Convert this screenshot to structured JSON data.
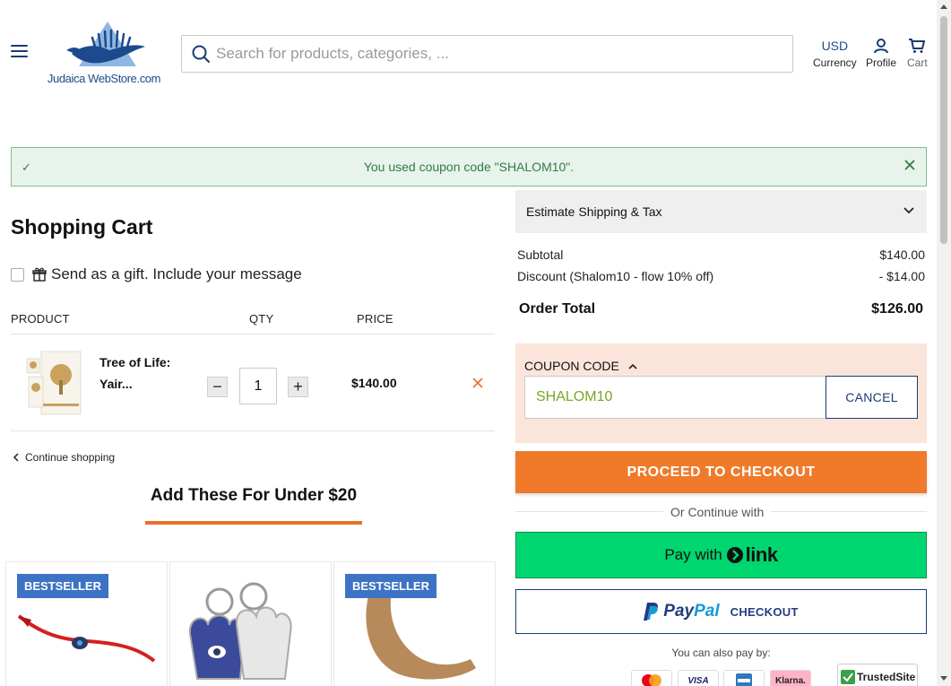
{
  "header": {
    "logo_text": "Judaica WebStore.com",
    "search_placeholder": "Search for products, categories, ...",
    "currency_code": "USD",
    "currency_label": "Currency",
    "profile_label": "Profile",
    "cart_label": "Cart"
  },
  "alert": {
    "message": "You used coupon code \"SHALOM10\".",
    "color": "#2e7d43"
  },
  "cart": {
    "title": "Shopping Cart",
    "gift_label": "Send as a gift. Include your message",
    "columns": {
      "product": "PRODUCT",
      "qty": "QTY",
      "price": "PRICE"
    },
    "items": [
      {
        "name": "Tree of Life: Yair...",
        "quantity": "1",
        "price": "$140.00"
      }
    ],
    "continue_label": "Continue shopping"
  },
  "upsell": {
    "title": "Add These For Under $20",
    "cards": [
      {
        "badge": "BESTSELLER"
      },
      {
        "badge": ""
      },
      {
        "badge": "BESTSELLER"
      }
    ]
  },
  "summary": {
    "shipping_label": "Estimate Shipping & Tax",
    "subtotal_label": "Subtotal",
    "subtotal_value": "$140.00",
    "discount_label": "Discount (Shalom10 - flow 10% off)",
    "discount_value": "- $14.00",
    "total_label": "Order Total",
    "total_value": "$126.00"
  },
  "coupon": {
    "label": "COUPON CODE",
    "value": "SHALOM10",
    "cancel_label": "CANCEL"
  },
  "checkout": {
    "proceed_label": "PROCEED TO CHECKOUT",
    "or_label": "Or Continue with",
    "link_pay_label": "Pay with",
    "link_word": "link",
    "paypal_word_1": "Pay",
    "paypal_word_2": "Pal",
    "paypal_checkout_label": "CHECKOUT",
    "also_pay_label": "You can also pay by:",
    "payment_methods": [
      "mastercard-icon",
      "VISA",
      "amex-icon",
      "Klarna."
    ],
    "trusted_label": "TrustedSite"
  },
  "colors": {
    "accent_orange": "#f07a2a",
    "navy": "#1a3b73",
    "link_green": "#00d66f",
    "badge_blue": "#3d73c4"
  }
}
